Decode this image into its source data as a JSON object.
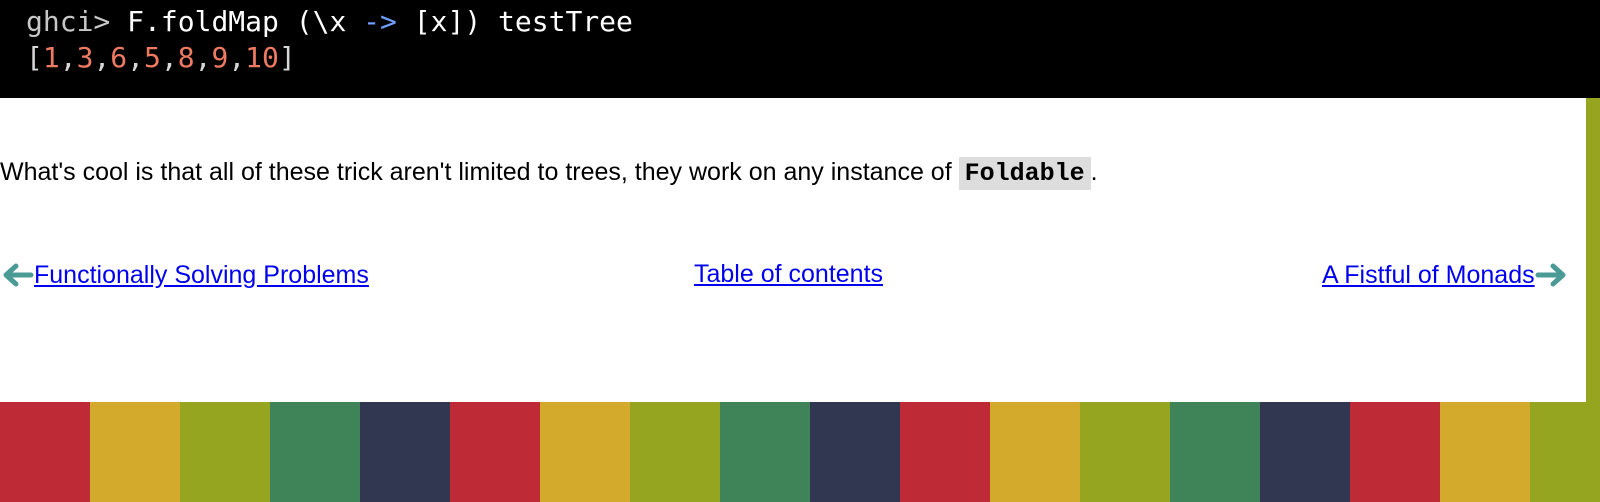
{
  "code_block": {
    "prompt": "ghci>",
    "command_pre": "F.foldMap (\\x ",
    "command_op": "->",
    "command_post": " [x]) testTree",
    "result_open": "[",
    "result_values": [
      "1",
      "3",
      "6",
      "5",
      "8",
      "9",
      "10"
    ],
    "result_close": "]"
  },
  "paragraph": {
    "text_before": "What's cool is that all of these trick aren't limited to trees, they work on any instance of ",
    "code": "Foldable",
    "text_after": "."
  },
  "navigation": {
    "prev_label": "Functionally Solving Problems",
    "toc_label": "Table of contents",
    "next_label": "A Fistful of Monads"
  },
  "colors": {
    "code_bg": "#000000",
    "number_color": "#ee7a62",
    "operator_color": "#6fa2ff",
    "link_color": "#0000ee",
    "arrow_color": "#4a9a95",
    "stripe_palette": [
      "#be2b36",
      "#d4aa2c",
      "#95a520",
      "#3f8458",
      "#313750"
    ]
  },
  "icons": {
    "prev": "left-arrow-icon",
    "next": "right-arrow-icon"
  }
}
